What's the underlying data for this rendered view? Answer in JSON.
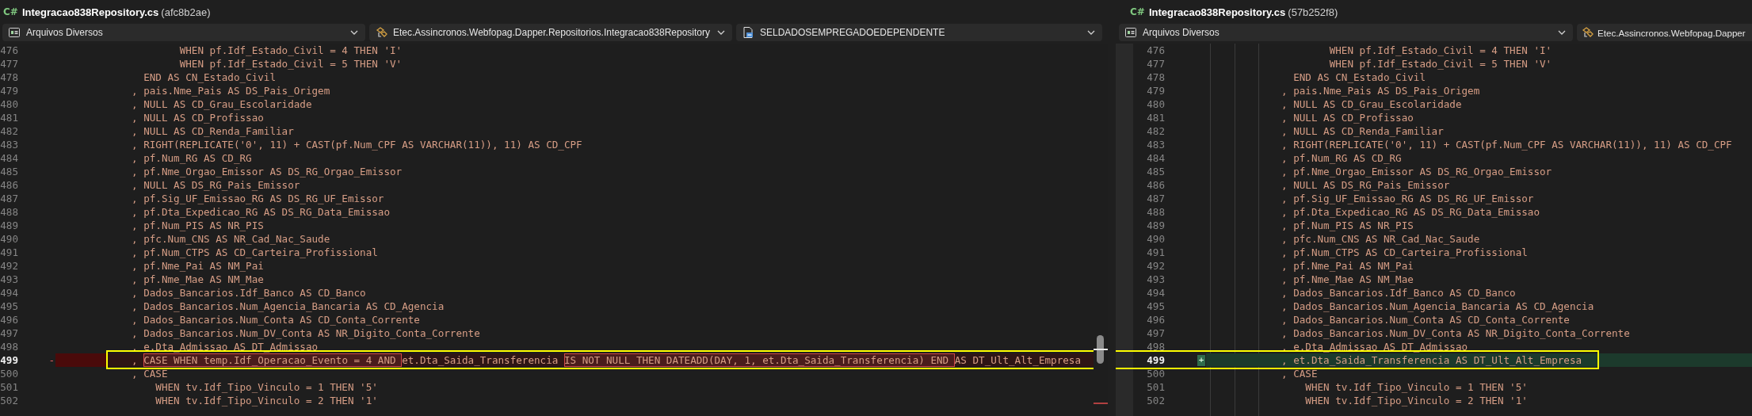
{
  "panes": [
    {
      "language_badge": "C#",
      "file_name": "Integracao838Repository.cs",
      "commit": "(afc8b2ae)",
      "overview_scrollbar": true,
      "dropdowns": [
        {
          "label": "Arquivos Diversos",
          "has_chevron": true
        },
        {
          "label": "Etec.Assincronos.Webfopag.Dapper.Repositorios.Integracao838Repository",
          "has_chevron": true
        },
        {
          "label": "SELDADOSEMPREGADOEDEPENDENTE",
          "has_chevron": true
        }
      ],
      "lines": [
        {
          "number": "476",
          "kind": "context",
          "text": "        WHEN pf.Idf_Estado_Civil = 4 THEN 'I'"
        },
        {
          "number": "477",
          "kind": "context",
          "text": "        WHEN pf.Idf_Estado_Civil = 5 THEN 'V'"
        },
        {
          "number": "478",
          "kind": "context",
          "text": "  END AS CN_Estado_Civil"
        },
        {
          "number": "479",
          "kind": "context",
          "text": ", pais.Nme_Pais AS DS_Pais_Origem"
        },
        {
          "number": "480",
          "kind": "context",
          "text": ", NULL AS CD_Grau_Escolaridade"
        },
        {
          "number": "481",
          "kind": "context",
          "text": ", NULL AS CD_Profissao"
        },
        {
          "number": "482",
          "kind": "context",
          "text": ", NULL AS CD_Renda_Familiar"
        },
        {
          "number": "483",
          "kind": "context",
          "text": ", RIGHT(REPLICATE('0', 11) + CAST(pf.Num_CPF AS VARCHAR(11)), 11) AS CD_CPF"
        },
        {
          "number": "484",
          "kind": "context",
          "text": ", pf.Num_RG AS CD_RG"
        },
        {
          "number": "485",
          "kind": "context",
          "text": ", pf.Nme_Orgao_Emissor AS DS_RG_Orgao_Emissor"
        },
        {
          "number": "486",
          "kind": "context",
          "text": ", NULL AS DS_RG_Pais_Emissor"
        },
        {
          "number": "487",
          "kind": "context",
          "text": ", pf.Sig_UF_Emissao_RG AS DS_RG_UF_Emissor"
        },
        {
          "number": "488",
          "kind": "context",
          "text": ", pf.Dta_Expedicao_RG AS DS_RG_Data_Emissao"
        },
        {
          "number": "489",
          "kind": "context",
          "text": ", pf.Num_PIS AS NR_PIS"
        },
        {
          "number": "490",
          "kind": "context",
          "text": ", pfc.Num_CNS AS NR_Cad_Nac_Saude"
        },
        {
          "number": "491",
          "kind": "context",
          "text": ", pf.Num_CTPS AS CD_Carteira_Profissional"
        },
        {
          "number": "492",
          "kind": "context",
          "text": ", pf.Nme_Pai AS NM_Pai"
        },
        {
          "number": "493",
          "kind": "context",
          "text": ", pf.Nme_Mae AS NM_Mae"
        },
        {
          "number": "494",
          "kind": "context",
          "text": ", Dados_Bancarios.Idf_Banco AS CD_Banco"
        },
        {
          "number": "495",
          "kind": "context",
          "text": ", Dados_Bancarios.Num_Agencia_Bancaria AS CD_Agencia"
        },
        {
          "number": "496",
          "kind": "context",
          "text": ", Dados_Bancarios.Num_Conta AS CD_Conta_Corrente"
        },
        {
          "number": "497",
          "kind": "context",
          "text": ", Dados_Bancarios.Num_DV_Conta AS NR_Digito_Conta_Corrente"
        },
        {
          "number": "498",
          "kind": "context",
          "text": ", e.Dta_Admissao AS DT_Admissao"
        },
        {
          "number": "499",
          "kind": "removed",
          "marker": "-",
          "annotated": true,
          "segments": [
            {
              "text": ", ",
              "changed": false
            },
            {
              "text": "CASE WHEN temp.Idf_Operacao_Evento = 4 AND ",
              "changed": true
            },
            {
              "text": "et.Dta_Saida_Transferencia ",
              "changed": false
            },
            {
              "text": "IS NOT NULL THEN DATEADD(DAY, 1, et.Dta_Saida_Transferencia) END ",
              "changed": true
            },
            {
              "text": "AS DT_Ult_Alt_Empresa",
              "changed": false
            }
          ]
        },
        {
          "number": "500",
          "kind": "context",
          "text": ", CASE"
        },
        {
          "number": "501",
          "kind": "context",
          "text": "    WHEN tv.Idf_Tipo_Vinculo = 1 THEN '5'"
        },
        {
          "number": "502",
          "kind": "context",
          "text": "    WHEN tv.Idf_Tipo_Vinculo = 2 THEN '1'"
        }
      ]
    },
    {
      "language_badge": "C#",
      "file_name": "Integracao838Repository.cs",
      "commit": "(57b252f8)",
      "dropdowns": [
        {
          "label": "Arquivos Diversos",
          "has_chevron": true
        },
        {
          "label": "Etec.Assincronos.Webfopag.Dapper",
          "has_chevron": false
        }
      ],
      "lines": [
        {
          "number": "476",
          "kind": "context",
          "text": "        WHEN pf.Idf_Estado_Civil = 4 THEN 'I'"
        },
        {
          "number": "477",
          "kind": "context",
          "text": "        WHEN pf.Idf_Estado_Civil = 5 THEN 'V'"
        },
        {
          "number": "478",
          "kind": "context",
          "text": "  END AS CN_Estado_Civil"
        },
        {
          "number": "479",
          "kind": "context",
          "text": ", pais.Nme_Pais AS DS_Pais_Origem"
        },
        {
          "number": "480",
          "kind": "context",
          "text": ", NULL AS CD_Grau_Escolaridade"
        },
        {
          "number": "481",
          "kind": "context",
          "text": ", NULL AS CD_Profissao"
        },
        {
          "number": "482",
          "kind": "context",
          "text": ", NULL AS CD_Renda_Familiar"
        },
        {
          "number": "483",
          "kind": "context",
          "text": ", RIGHT(REPLICATE('0', 11) + CAST(pf.Num_CPF AS VARCHAR(11)), 11) AS CD_CPF"
        },
        {
          "number": "484",
          "kind": "context",
          "text": ", pf.Num_RG AS CD_RG"
        },
        {
          "number": "485",
          "kind": "context",
          "text": ", pf.Nme_Orgao_Emissor AS DS_RG_Orgao_Emissor"
        },
        {
          "number": "486",
          "kind": "context",
          "text": ", NULL AS DS_RG_Pais_Emissor"
        },
        {
          "number": "487",
          "kind": "context",
          "text": ", pf.Sig_UF_Emissao_RG AS DS_RG_UF_Emissor"
        },
        {
          "number": "488",
          "kind": "context",
          "text": ", pf.Dta_Expedicao_RG AS DS_RG_Data_Emissao"
        },
        {
          "number": "489",
          "kind": "context",
          "text": ", pf.Num_PIS AS NR_PIS"
        },
        {
          "number": "490",
          "kind": "context",
          "text": ", pfc.Num_CNS AS NR_Cad_Nac_Saude"
        },
        {
          "number": "491",
          "kind": "context",
          "text": ", pf.Num_CTPS AS CD_Carteira_Profissional"
        },
        {
          "number": "492",
          "kind": "context",
          "text": ", pf.Nme_Pai AS NM_Pai"
        },
        {
          "number": "493",
          "kind": "context",
          "text": ", pf.Nme_Mae AS NM_Mae"
        },
        {
          "number": "494",
          "kind": "context",
          "text": ", Dados_Bancarios.Idf_Banco AS CD_Banco"
        },
        {
          "number": "495",
          "kind": "context",
          "text": ", Dados_Bancarios.Num_Agencia_Bancaria AS CD_Agencia"
        },
        {
          "number": "496",
          "kind": "context",
          "text": ", Dados_Bancarios.Num_Conta AS CD_Conta_Corrente"
        },
        {
          "number": "497",
          "kind": "context",
          "text": ", Dados_Bancarios.Num_DV_Conta AS NR_Digito_Conta_Corrente"
        },
        {
          "number": "498",
          "kind": "context",
          "text": ", e.Dta_Admissao AS DT_Admissao"
        },
        {
          "number": "499",
          "kind": "added",
          "marker": "+",
          "annotated": true,
          "text": ", et.Dta_Saida_Transferencia AS DT_Ult_Alt_Empresa"
        },
        {
          "number": "500",
          "kind": "context",
          "text": ", CASE"
        },
        {
          "number": "501",
          "kind": "context",
          "text": "    WHEN tv.Idf_Tipo_Vinculo = 1 THEN '5'"
        },
        {
          "number": "502",
          "kind": "context",
          "text": "    WHEN tv.Idf_Tipo_Vinculo = 2 THEN '1'"
        }
      ]
    }
  ]
}
